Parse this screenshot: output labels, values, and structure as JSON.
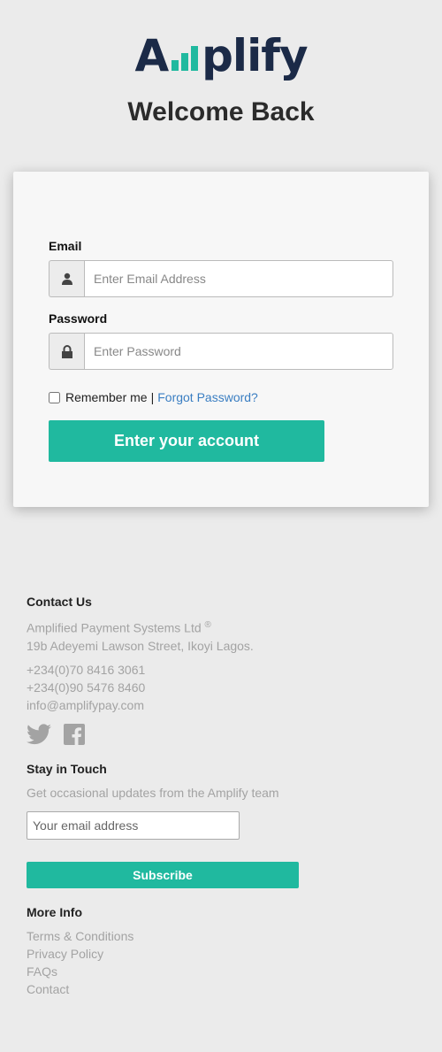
{
  "logo": {
    "prefix": "A",
    "suffix": "plify",
    "full": "Amplify"
  },
  "title": "Welcome Back",
  "form": {
    "email_label": "Email",
    "email_placeholder": "Enter Email Address",
    "password_label": "Password",
    "password_placeholder": "Enter Password",
    "remember": "Remember me",
    "separator": "|",
    "forgot": "Forgot Password?",
    "submit": "Enter your account"
  },
  "footer": {
    "contact_heading": "Contact Us",
    "company": "Amplified Payment Systems Ltd",
    "reg": "®",
    "address": "19b Adeyemi Lawson Street, Ikoyi Lagos.",
    "phone1": "+234(0)70 8416 3061",
    "phone2": "+234(0)90 5476 8460",
    "email": "info@amplifypay.com",
    "stay_heading": "Stay in Touch",
    "stay_text": "Get occasional updates from the Amplify team",
    "sub_placeholder": "Your email address",
    "sub_button": "Subscribe",
    "more_heading": "More Info",
    "links": [
      "Terms & Conditions",
      "Privacy Policy",
      "FAQs",
      "Contact"
    ]
  },
  "colors": {
    "accent": "#20b99f",
    "brand": "#1b2a47",
    "link": "#3a7ec2"
  }
}
